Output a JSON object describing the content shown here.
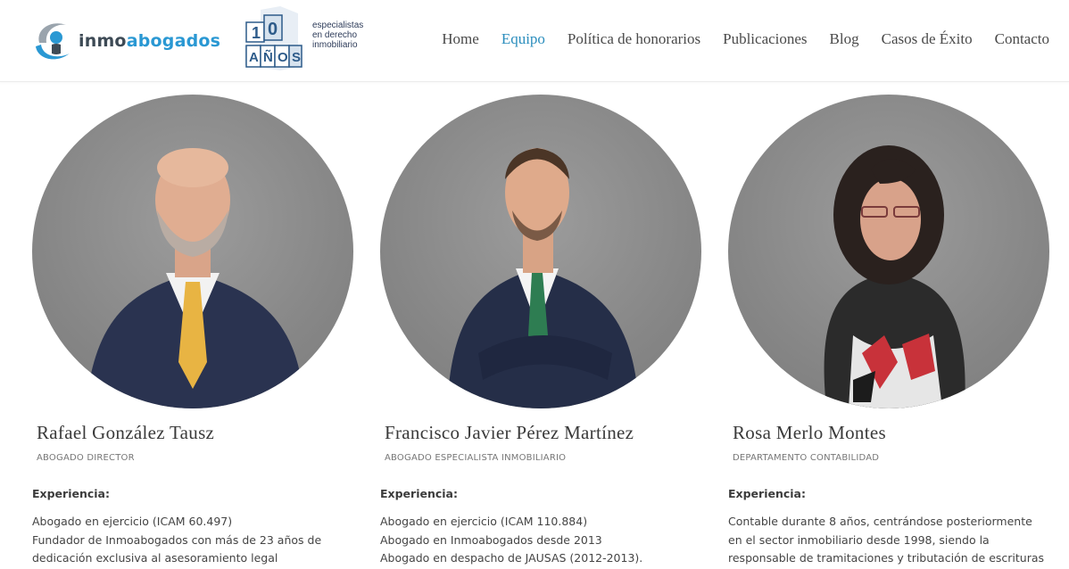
{
  "header": {
    "logo": {
      "text_main": "inmo",
      "text_accent": "abogados"
    },
    "anniversary": {
      "number": "10",
      "word": "AÑOS",
      "tagline": [
        "especialistas",
        "en derecho",
        "inmobiliario"
      ]
    },
    "nav": [
      {
        "label": "Home",
        "active": false
      },
      {
        "label": "Equipo",
        "active": true
      },
      {
        "label": "Política de honorarios",
        "active": false
      },
      {
        "label": "Publicaciones",
        "active": false
      },
      {
        "label": "Blog",
        "active": false
      },
      {
        "label": "Casos de Éxito",
        "active": false
      },
      {
        "label": "Contacto",
        "active": false
      }
    ]
  },
  "team": [
    {
      "name": "Rafael González Tausz",
      "role": "ABOGADO DIRECTOR",
      "experience_title": "Experiencia:",
      "experience": [
        "Abogado en ejercicio (ICAM 60.497)",
        "Fundador de Inmoabogados con más de 23 años de",
        "dedicación exclusiva al asesoramiento legal"
      ]
    },
    {
      "name": "Francisco Javier Pérez Martínez",
      "role": "ABOGADO ESPECIALISTA INMOBILIARIO",
      "experience_title": "Experiencia:",
      "experience": [
        "Abogado en ejercicio (ICAM 110.884)",
        "Abogado en Inmoabogados desde 2013",
        "Abogado en despacho de JAUSAS (2012-2013)."
      ]
    },
    {
      "name": "Rosa Merlo Montes",
      "role": "DEPARTAMENTO CONTABILIDAD",
      "experience_title": "Experiencia:",
      "experience": [
        "Contable durante 8 años, centrándose posteriormente",
        "en el sector inmobiliario desde 1998, siendo la",
        "responsable de tramitaciones y tributación de escrituras"
      ]
    }
  ],
  "colors": {
    "accent": "#2a8dbd",
    "logo_blue": "#2a98d3",
    "photo_bg": "#8a8a8a"
  }
}
